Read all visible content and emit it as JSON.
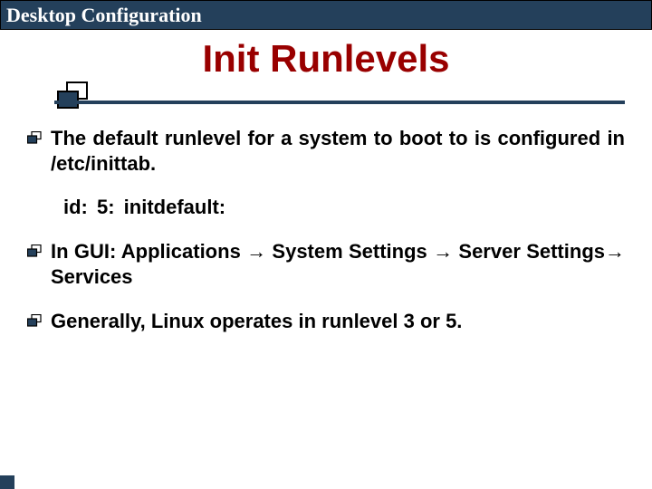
{
  "banner": {
    "title": "Desktop Configuration"
  },
  "title": "Init Runlevels",
  "bullets": [
    "The default runlevel for a system to boot to is configured in /etc/inittab.",
    "In GUI: Applications → System Settings → Server Settings→ Services",
    "Generally, Linux operates in runlevel 3 or 5."
  ],
  "code": "id: 5: initdefault:",
  "colors": {
    "banner": "#24405b",
    "title": "#990000"
  }
}
